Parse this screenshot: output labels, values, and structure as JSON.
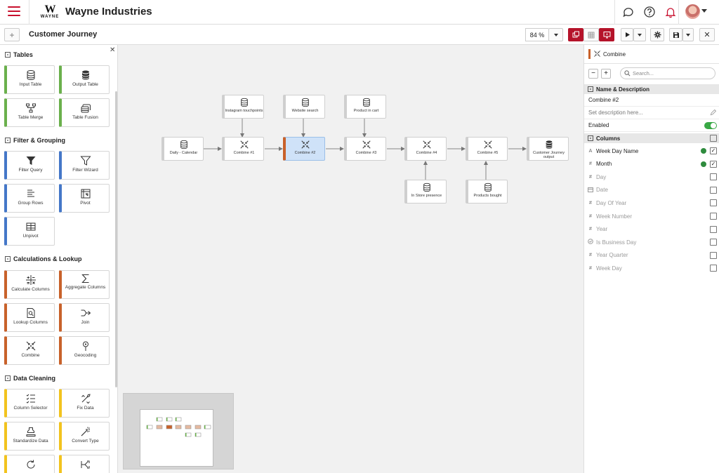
{
  "app": {
    "company": "Wayne Industries",
    "logo_mark": "W",
    "logo_text": "WAYNE"
  },
  "header_icons": [
    "menu-icon",
    "chat-icon",
    "help-icon",
    "bell-icon",
    "avatar"
  ],
  "toolbar": {
    "title": "Customer Journey",
    "zoom": "84 %"
  },
  "palette": {
    "sections": {
      "tables": "Tables",
      "filter": "Filter & Grouping",
      "calc": "Calculations & Lookup",
      "cleaning": "Data Cleaning"
    },
    "tools": {
      "input_table": "Input Table",
      "output_table": "Output Table",
      "table_merge": "Table Merge",
      "table_fusion": "Table Fusion",
      "filter_query": "Filter Query",
      "filter_wizard": "Filter Wizard",
      "group_rows": "Group Rows",
      "pivot": "Pivot",
      "unpivot": "Unpivot",
      "calculate_columns": "Calculate Columns",
      "aggregate_columns": "Aggregate Columns",
      "lookup_columns": "Lookup Columns",
      "join": "Join",
      "combine": "Combine",
      "geocoding": "Geocoding",
      "column_selector": "Column Selector",
      "fix_data": "Fix Data",
      "standardize_data": "Standardize Data",
      "convert_type": "Convert Type"
    }
  },
  "flow": {
    "nodes": {
      "instagram": "Instagram touchpoints",
      "website": "Website search",
      "product_cart": "Product in cart",
      "daily": "Daily - Calendar",
      "combine1": "Combine #1",
      "combine2": "Combine #2",
      "combine3": "Combine #3",
      "combine4": "Combine #4",
      "combine5": "Combine #5",
      "output": "Customer Journey output",
      "instore": "In Store presence",
      "products": "Products bought"
    }
  },
  "right_panel": {
    "title": "Combine",
    "search_placeholder": "Search...",
    "name_desc_header": "Name & Description",
    "name": "Combine #2",
    "description_placeholder": "Set description here...",
    "enabled_label": "Enabled",
    "enabled": true,
    "columns_header": "Columns",
    "columns": [
      {
        "name": "Week Day Name",
        "type_icon": "A",
        "checked": true,
        "active": true
      },
      {
        "name": "Month",
        "type_icon": "#",
        "checked": true,
        "active": true
      },
      {
        "name": "Day",
        "type_icon": "#",
        "checked": false,
        "active": false
      },
      {
        "name": "Date",
        "type_icon": "calendar",
        "checked": false,
        "active": false
      },
      {
        "name": "Day Of Year",
        "type_icon": "#",
        "checked": false,
        "active": false
      },
      {
        "name": "Week Number",
        "type_icon": "#",
        "checked": false,
        "active": false
      },
      {
        "name": "Year",
        "type_icon": "#",
        "checked": false,
        "active": false
      },
      {
        "name": "Is Business Day",
        "type_icon": "check-circle",
        "checked": false,
        "active": false
      },
      {
        "name": "Year Quarter",
        "type_icon": "#",
        "checked": false,
        "active": false
      },
      {
        "name": "Week Day",
        "type_icon": "#",
        "checked": false,
        "active": false
      }
    ]
  },
  "colors": {
    "brand": "#c8102e",
    "toolbar_red": "#b5132a",
    "table_tools": "#6ab04c",
    "filter_tools": "#4477c8",
    "calc_tools": "#c8612a",
    "cleaning_tools": "#f2c31e",
    "selected_node": "#cfe2f8"
  }
}
